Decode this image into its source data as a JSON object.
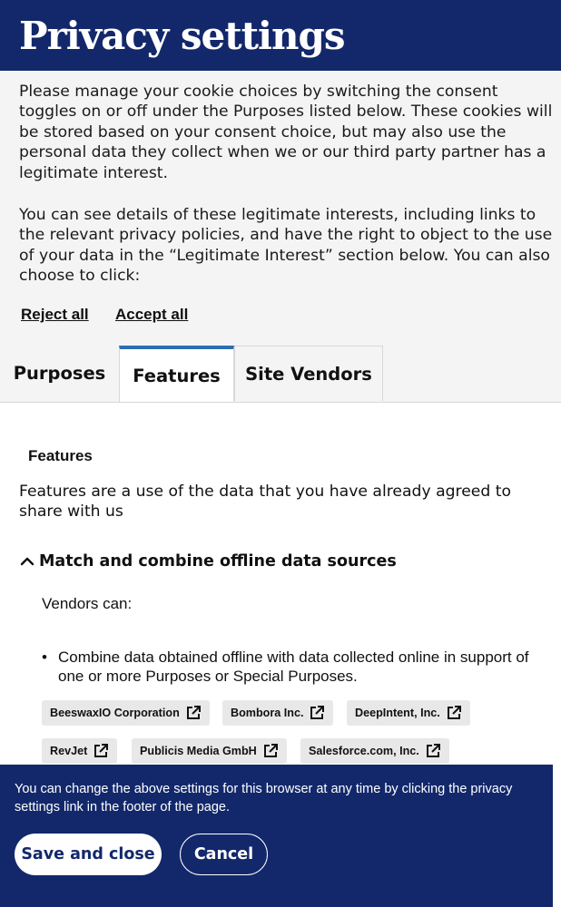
{
  "header": {
    "title": "Privacy settings"
  },
  "intro": {
    "paragraph1": "Please manage your cookie choices by switching the consent toggles on or off under the Purposes listed below. These cookies will be stored based on your consent choice, but may also use the personal data they collect when we or our third party partner has a legitimate interest.",
    "paragraph2": "You can see details of these legitimate interests, including links to the relevant privacy policies, and have the right to object to the use of your data in the “Legitimate Interest” section below. You can also choose to click:"
  },
  "actions": {
    "reject_all": "Reject all",
    "accept_all": "Accept all"
  },
  "tabs": [
    {
      "label": "Purposes",
      "active": false
    },
    {
      "label": "Features",
      "active": true
    },
    {
      "label": "Site Vendors",
      "active": false
    }
  ],
  "features": {
    "title": "Features",
    "description": "Features are a use of the data that you have already agreed to share with us",
    "accordion": {
      "title": "Match and combine offline data sources",
      "expanded": true,
      "vendors_can": "Vendors can:",
      "bullets": [
        "Combine data obtained offline with data collected online in support of one or more Purposes or Special Purposes."
      ]
    },
    "vendors": [
      "BeeswaxIO Corporation",
      "Bombora Inc.",
      "DeepIntent, Inc.",
      "RevJet",
      "Publicis Media GmbH",
      "Salesforce.com, Inc."
    ]
  },
  "footer": {
    "text": "You can change the above settings for this browser at any time by clicking the privacy settings link in the footer of the page.",
    "save_label": "Save and close",
    "cancel_label": "Cancel"
  },
  "colors": {
    "brand_navy": "#13286b",
    "tab_active_accent": "#2e6db4",
    "panel_bg": "#f4f4f4",
    "chip_bg": "#e8e8e8"
  },
  "icons": {
    "external_link": "external-link-icon",
    "chevron": "chevron-up-icon"
  }
}
